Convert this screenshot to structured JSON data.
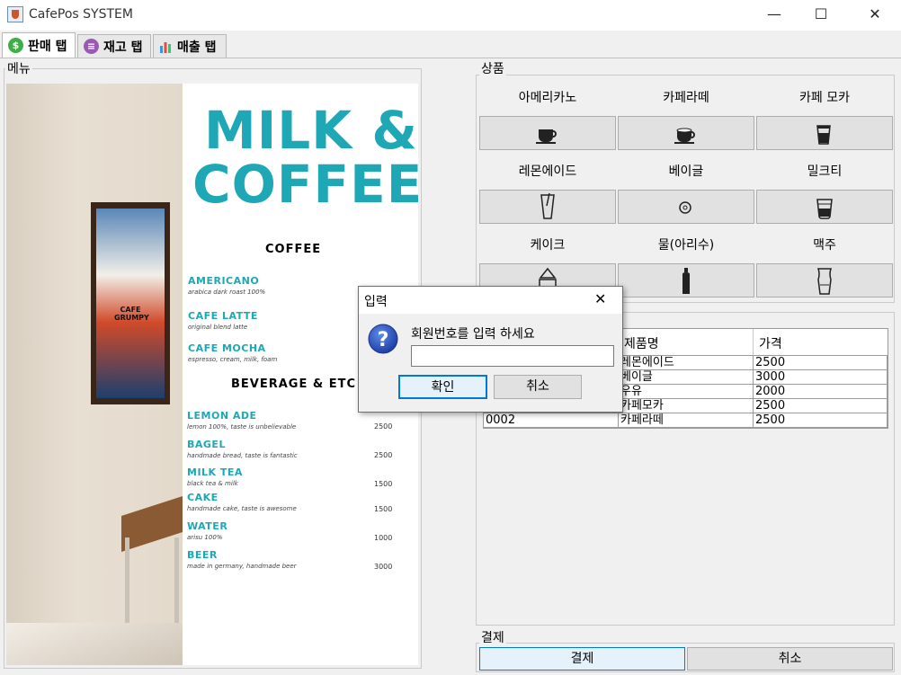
{
  "window": {
    "title": "CafePos SYSTEM",
    "minimize": "—",
    "maximize": "☐",
    "close": "✕"
  },
  "tabs": [
    {
      "label": "판매 탭",
      "icon": "dollar-icon",
      "color": "#3fae49"
    },
    {
      "label": "재고 탭",
      "icon": "list-icon",
      "color": "#9b59b6"
    },
    {
      "label": "매출 탭",
      "icon": "bar-chart-icon",
      "color": "#e67e22"
    }
  ],
  "menu_panel": {
    "label": "메뉴",
    "poster": {
      "title_line1": "MILK &",
      "title_line2": "COFFEE",
      "section_coffee": "COFFEE",
      "coffee_items": [
        {
          "name": "AMERICANO",
          "desc": "arabica dark roast 100%"
        },
        {
          "name": "CAFE LATTE",
          "desc": "original blend latte"
        },
        {
          "name": "CAFE MOCHA",
          "desc": "espresso, cream, milk, foam"
        }
      ],
      "section_beverage": "BEVERAGE & ETC",
      "beverage_items": [
        {
          "name": "LEMON ADE",
          "desc": "lemon 100%, taste  is unbelievable",
          "price": "2500"
        },
        {
          "name": "BAGEL",
          "desc": "handmade bread, taste is fantastic",
          "price": "2500"
        },
        {
          "name": "MILK TEA",
          "desc": "black tea & milk",
          "price": "1500"
        },
        {
          "name": "CAKE",
          "desc": "handmade cake, taste is awesome",
          "price": "1500"
        },
        {
          "name": "WATER",
          "desc": "arisu 100%",
          "price": "1000"
        },
        {
          "name": "BEER",
          "desc": "made in germany, handmade beer",
          "price": "3000"
        }
      ],
      "frame_art_text": [
        "CAFE",
        "GRUMPY"
      ]
    }
  },
  "products_panel": {
    "label": "상품",
    "items": [
      {
        "label": "아메리카노",
        "icon": "coffee-cup-icon"
      },
      {
        "label": "카페라떼",
        "icon": "latte-cup-icon"
      },
      {
        "label": "카페 모카",
        "icon": "mocha-glass-icon"
      },
      {
        "label": "레몬에이드",
        "icon": "tall-glass-icon"
      },
      {
        "label": "베이글",
        "icon": "bagel-icon"
      },
      {
        "label": "밀크티",
        "icon": "milk-tea-icon"
      },
      {
        "label": "케이크",
        "icon": "cake-icon"
      },
      {
        "label": "물(아리수)",
        "icon": "water-bottle-icon"
      },
      {
        "label": "맥주",
        "icon": "beer-glass-icon"
      }
    ]
  },
  "order_table": {
    "columns": [
      "",
      "제품명",
      "가격"
    ],
    "rows": [
      [
        "",
        "레몬에이드",
        "2500"
      ],
      [
        "",
        "베이글",
        "3000"
      ],
      [
        "",
        "우유",
        "2000"
      ],
      [
        "",
        "카페모카",
        "2500"
      ],
      [
        "0002",
        "카페라떼",
        "2500"
      ]
    ]
  },
  "payment_panel": {
    "label": "결제",
    "pay_button": "결제",
    "cancel_button": "취소"
  },
  "dialog": {
    "title": "입력",
    "close": "✕",
    "message": "회원번호를 입력 하세요",
    "input_value": "",
    "ok_button": "확인",
    "cancel_button": "취소",
    "icon": "question-icon"
  }
}
